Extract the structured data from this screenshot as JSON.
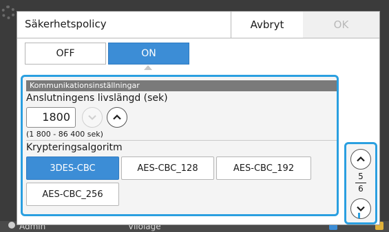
{
  "dialog": {
    "title": "Säkerhetspolicy",
    "cancel_label": "Avbryt",
    "ok_label": "OK"
  },
  "toggle": {
    "off_label": "OFF",
    "on_label": "ON",
    "selected": "ON"
  },
  "communication": {
    "section_heading": "Kommunikationsinställningar",
    "lifetime_label": "Anslutningens livslängd (sek)",
    "lifetime_value": "1800",
    "lifetime_range": "(1 800 - 86 400 sek)"
  },
  "encryption": {
    "label": "Krypteringsalgoritm",
    "options": [
      "3DES-CBC",
      "AES-CBC_128",
      "AES-CBC_192",
      "AES-CBC_256"
    ],
    "selected": "3DES-CBC"
  },
  "pager": {
    "current": "5",
    "total": "6"
  },
  "background": {
    "user": "Admin",
    "mode": "Vilolage"
  },
  "colors": {
    "accent": "#2a9fe0",
    "selected_fill": "#3c8dd6",
    "disabled_text": "#b9b9b9"
  }
}
